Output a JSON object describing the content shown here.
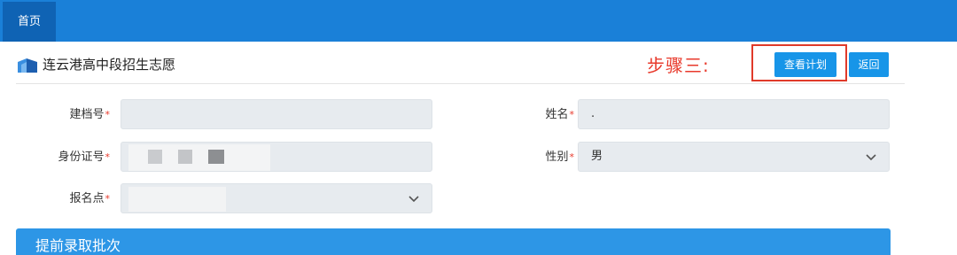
{
  "nav": {
    "home_label": "首页"
  },
  "header": {
    "title": "连云港高中段招生志愿"
  },
  "annotation": {
    "step_label": "步骤三:"
  },
  "buttons": {
    "view_plan": "查看计划",
    "back": "返回"
  },
  "form": {
    "file_no_label": "建档号",
    "name_label": "姓名",
    "name_value": ".",
    "id_card_label": "身份证号",
    "gender_label": "性别",
    "gender_value": "男",
    "enroll_site_label": "报名点",
    "required_mark": "*"
  },
  "section": {
    "title": "提前录取批次"
  },
  "colors": {
    "accent": "#1795e8",
    "nav_bg": "#1a80d8",
    "annotation_red": "#e8392b"
  }
}
